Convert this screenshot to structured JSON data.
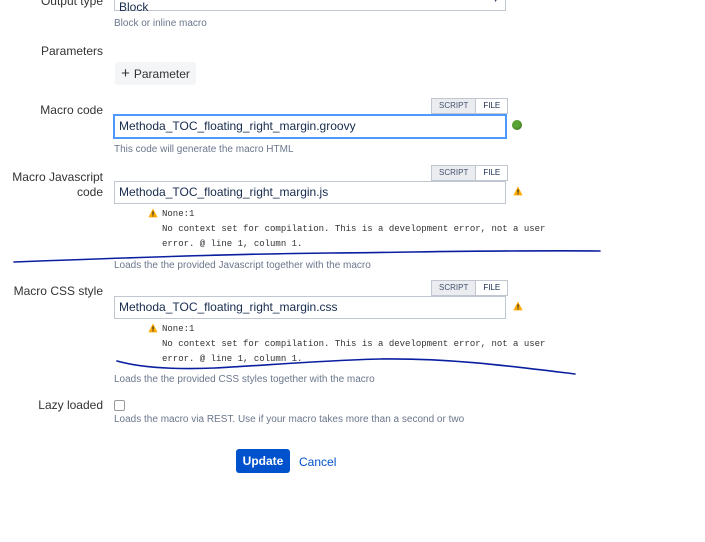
{
  "output_type": {
    "label": "Output type",
    "value": "Block",
    "help": "Block or inline macro"
  },
  "parameters": {
    "label": "Parameters",
    "button_label": "Parameter"
  },
  "macro_code": {
    "label": "Macro code",
    "tabs": [
      "SCRIPT",
      "FILE"
    ],
    "value": "Methoda_TOC_floating_right_margin.groovy",
    "help": "This code will generate the macro HTML"
  },
  "macro_js": {
    "label_line1": "Macro Javascript",
    "label_line2": "code",
    "tabs": [
      "SCRIPT",
      "FILE"
    ],
    "value": "Methoda_TOC_floating_right_margin.js",
    "error_title": "None:1",
    "error_line1": "No context set for compilation. This is a development error, not a user",
    "error_line2": "error. @ line 1, column 1.",
    "help": "Loads the the provided Javascript together with the macro"
  },
  "macro_css": {
    "label": "Macro CSS style",
    "tabs": [
      "SCRIPT",
      "FILE"
    ],
    "value": "Methoda_TOC_floating_right_margin.css",
    "error_title": "None:1",
    "error_line1": "No context set for compilation. This is a development error, not a user",
    "error_line2": "error. @ line 1, column 1.",
    "help": "Loads the the provided CSS styles together with the macro"
  },
  "lazy_loaded": {
    "label": "Lazy loaded",
    "checked": false,
    "help": "Loads the macro via REST. Use if your macro takes more than a second or two"
  },
  "actions": {
    "update_label": "Update",
    "cancel_label": "Cancel"
  },
  "colors": {
    "primary": "#0052cc",
    "ok": "#5aa532",
    "warning": "#ffab00",
    "annotation": "#0a1fa0"
  }
}
